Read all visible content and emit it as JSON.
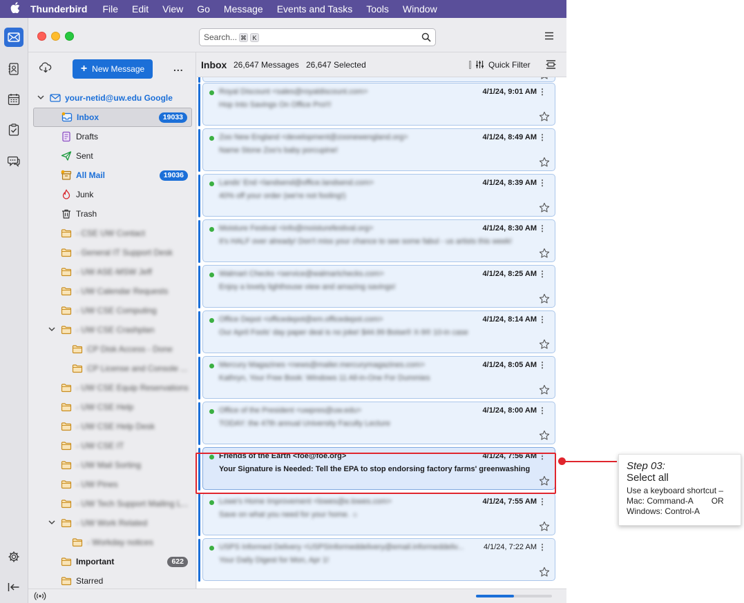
{
  "menubar": {
    "app_name": "Thunderbird",
    "items": [
      "File",
      "Edit",
      "View",
      "Go",
      "Message",
      "Events and Tasks",
      "Tools",
      "Window"
    ]
  },
  "search": {
    "placeholder": "Search...",
    "shortcut_keys": [
      "⌘",
      "K"
    ]
  },
  "folder_pane": {
    "new_message_label": "New Message",
    "more_label": "...",
    "account_name": "your-netid@uw.edu Google",
    "folders": [
      {
        "name": "Inbox",
        "badge": "19033",
        "badge_style": "blue",
        "style": "blue",
        "icon": "inbox-icon",
        "indent": 1,
        "selected": true
      },
      {
        "name": "Drafts",
        "icon": "drafts-icon",
        "indent": 1
      },
      {
        "name": "Sent",
        "icon": "sent-icon",
        "indent": 1
      },
      {
        "name": "All Mail",
        "badge": "19036",
        "badge_style": "blue",
        "style": "blue",
        "icon": "archive-icon",
        "indent": 1
      },
      {
        "name": "Junk",
        "icon": "junk-icon",
        "indent": 1
      },
      {
        "name": "Trash",
        "icon": "trash-icon",
        "indent": 1
      },
      {
        "name": "- CSE UW Contact",
        "icon": "folder-icon",
        "indent": 1,
        "blur": true
      },
      {
        "name": "- General IT Support Desk",
        "icon": "folder-icon",
        "indent": 1,
        "blur": true
      },
      {
        "name": "- UW ASE-MSW Jeff",
        "icon": "folder-icon",
        "indent": 1,
        "blur": true
      },
      {
        "name": "- UW Calendar Requests",
        "icon": "folder-icon",
        "indent": 1,
        "blur": true
      },
      {
        "name": "- UW CSE Computing",
        "icon": "folder-icon",
        "indent": 1,
        "blur": true
      },
      {
        "name": "- UW CSE Crashplan",
        "icon": "folder-icon",
        "indent": 1,
        "blur": true,
        "twisty": true
      },
      {
        "name": "CP Disk Access - Done",
        "icon": "folder-icon",
        "indent": 2,
        "blur": true
      },
      {
        "name": "CP License and Console ...",
        "icon": "folder-icon",
        "indent": 2,
        "blur": true
      },
      {
        "name": "- UW CSE Equip Reservations",
        "icon": "folder-icon",
        "indent": 1,
        "blur": true
      },
      {
        "name": "- UW CSE Help",
        "icon": "folder-icon",
        "indent": 1,
        "blur": true
      },
      {
        "name": "- UW CSE Help Desk",
        "icon": "folder-icon",
        "indent": 1,
        "blur": true
      },
      {
        "name": "- UW CSE IT",
        "icon": "folder-icon",
        "indent": 1,
        "blur": true
      },
      {
        "name": "- UW Mail Sorting",
        "icon": "folder-icon",
        "indent": 1,
        "blur": true
      },
      {
        "name": "- UW Pines",
        "icon": "folder-icon",
        "indent": 1,
        "blur": true
      },
      {
        "name": "- UW Tech Support Mailing L...",
        "icon": "folder-icon",
        "indent": 1,
        "blur": true
      },
      {
        "name": "- UW Work Related",
        "icon": "folder-icon",
        "indent": 1,
        "blur": true,
        "twisty": true
      },
      {
        "name": "- Workday notices",
        "icon": "folder-icon",
        "indent": 2,
        "blur": true
      },
      {
        "name": "Important",
        "badge": "622",
        "badge_style": "gray",
        "style": "bold",
        "icon": "folder-icon",
        "indent": 1
      },
      {
        "name": "Starred",
        "icon": "folder-icon",
        "indent": 1
      }
    ]
  },
  "thread_header": {
    "title": "Inbox",
    "message_count": "26,647 Messages",
    "selected_count": "26,647 Selected",
    "quick_filter_label": "Quick Filter"
  },
  "messages": [
    {
      "sender": "Royal Discount <sales@royaldiscount.com>",
      "subject": "Hop Into Savings On Office Pro!!!",
      "date": "4/1/24, 9:01 AM",
      "blur": true
    },
    {
      "sender": "Zoo New England <development@zoonewengland.org>",
      "subject": "Name Stone Zoo's baby porcupine!",
      "date": "4/1/24, 8:49 AM",
      "blur": true
    },
    {
      "sender": "Lands' End <landsend@office.landsend.com>",
      "subject": "40% off your order (we're not fooling!)",
      "date": "4/1/24, 8:39 AM",
      "blur": true
    },
    {
      "sender": "Moisture Festival <info@moisturefestival.org>",
      "subject": "It's HALF over already! Don't miss your chance to see some fabul - us artists this week!",
      "date": "4/1/24, 8:30 AM",
      "blur": true
    },
    {
      "sender": "Walmart Checks <service@walmartchecks.com>",
      "subject": "Enjoy a lovely lighthouse view and amazing savings!",
      "date": "4/1/24, 8:25 AM",
      "blur": true
    },
    {
      "sender": "Office Depot <officedepot@em.officedepot.com>",
      "subject": "Our April Fools' day paper deal is no joke! $44.99 Boise® X-9® 10-in case",
      "date": "4/1/24, 8:14 AM",
      "blur": true
    },
    {
      "sender": "Mercury Magazines <news@mailer.mercurymagazines.com>",
      "subject": "Kathryn, Your Free Book: Windows 11 All-in-One For Dummies",
      "date": "4/1/24, 8:05 AM",
      "blur": true
    },
    {
      "sender": "Office of the President <uwpres@uw.edu>",
      "subject": "TODAY: the 47th annual University Faculty Lecture",
      "date": "4/1/24, 8:00 AM",
      "blur": true
    },
    {
      "sender": "Friends of the Earth <foe@foe.org>",
      "subject": "Your Signature is Needed: Tell the EPA to stop endorsing factory farms' greenwashing",
      "date": "4/1/24, 7:56 AM",
      "blur": false,
      "highlighted": true
    },
    {
      "sender": "Lowe's Home Improvement <lowes@e.lowes.com>",
      "subject": "Save on what you need for your home. ☼",
      "date": "4/1/24, 7:55 AM",
      "blur": true
    },
    {
      "sender": "USPS Informed Delivery <USPSInformeddelivery@email.informeddeliv...",
      "subject": "Your Daily Digest for Mon, Apr 1!",
      "date": "4/1/24, 7:22 AM",
      "blur": true,
      "date_normal": true
    }
  ],
  "status": {
    "progress": 0.5
  },
  "annotation": {
    "step_number": "Step 03:",
    "step_title": "Select all",
    "line1": "Use a keyboard shortcut –",
    "line2_mac": "Mac: Command-A",
    "line2_or": "OR",
    "line3": "Windows: Control-A"
  },
  "colors": {
    "accent": "#1b6fd8",
    "menubar": "#5a4f9a",
    "highlight": "#e0252d",
    "unread_dot": "#3cb043"
  }
}
